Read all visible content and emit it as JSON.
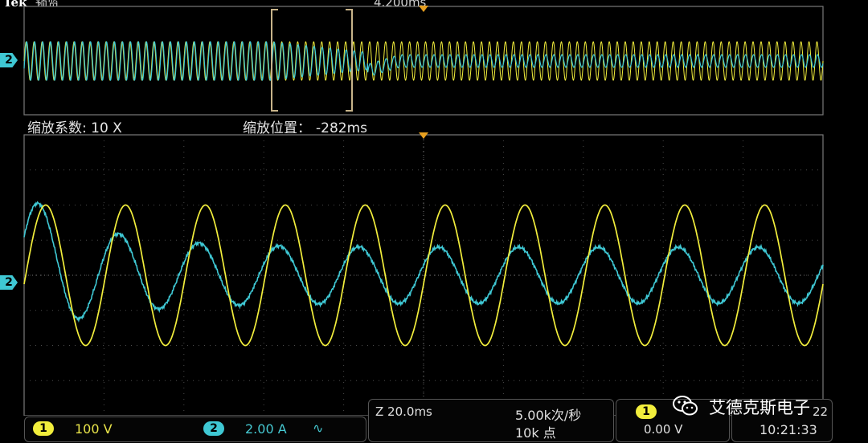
{
  "header": {
    "brand": "Tek",
    "title": "预览",
    "timebase_top": "4.200ms"
  },
  "zoom": {
    "factor_label": "缩放系数: 10 X",
    "position_label": "缩放位置：",
    "position_value": "-282ms"
  },
  "channels": {
    "ch1": {
      "badge": "1",
      "scale": "100 V",
      "color": "#f2ee3c"
    },
    "ch2": {
      "badge": "2",
      "scale": "2.00 A",
      "coupling_symbol": "∿",
      "color": "#3fc8d4"
    }
  },
  "acquisition": {
    "zoom_timebase": "Z 20.0ms",
    "sample_rate": "5.00k次/秒",
    "record_length": "10k 点"
  },
  "trigger": {
    "badge": "1",
    "level": "0.00 V"
  },
  "clock": {
    "date_fragment": "22",
    "time": "10:21:33"
  },
  "watermark": {
    "icon": "wechat-icon",
    "text": "艾德克斯电子"
  },
  "chart_data": {
    "type": "line",
    "title": "",
    "series": [
      {
        "name": "1",
        "color": "#f2ee3c",
        "amplitude_div": 2.0,
        "period_div": 1.0,
        "phase_cycles": 0.02,
        "variation": "constant"
      },
      {
        "name": "2",
        "color": "#3fc8d4",
        "amplitude_div_start": 2.0,
        "amplitude_div_end": 0.8,
        "period_div": 1.0,
        "phase_cycles": -0.06,
        "variation": "decaying-to-steady"
      }
    ],
    "grid": {
      "horizontal_divisions": 10,
      "vertical_divisions": 8,
      "visible": true
    },
    "xlim": [
      0,
      10
    ],
    "ylim": [
      -4,
      4
    ]
  }
}
